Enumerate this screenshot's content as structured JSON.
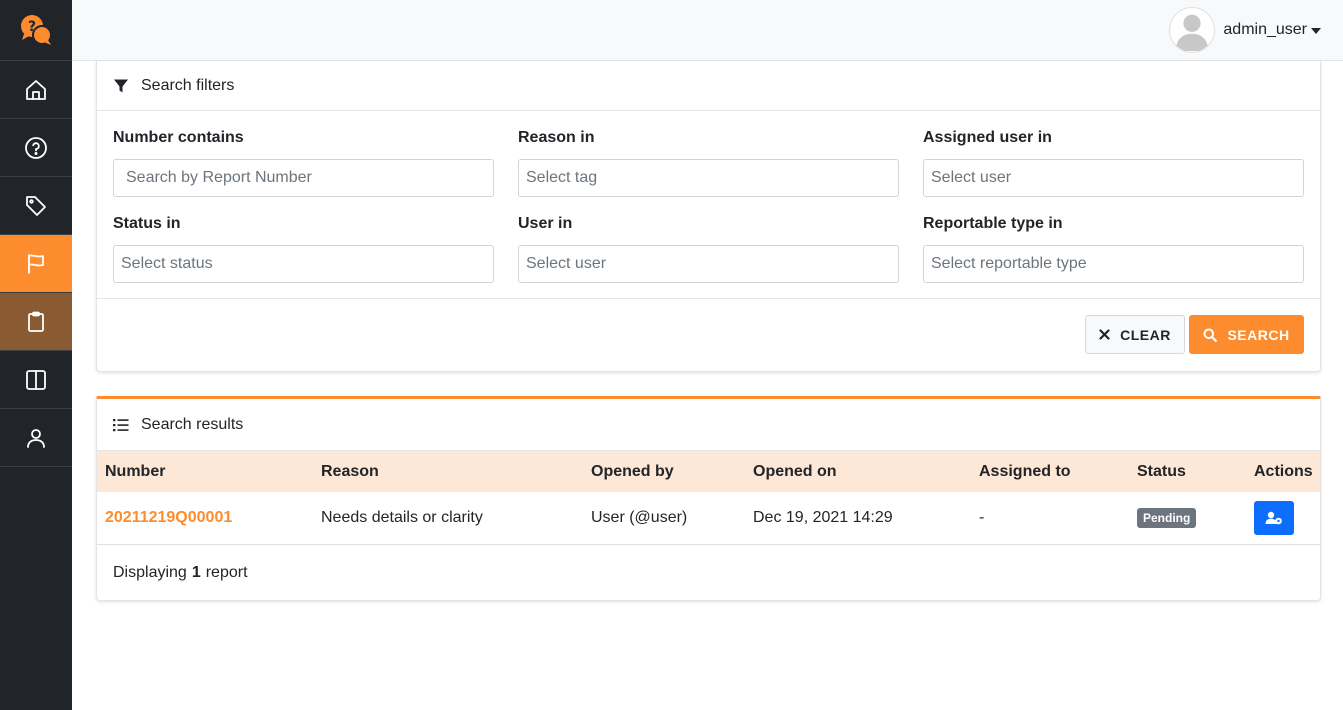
{
  "user": {
    "name": "admin_user"
  },
  "sidebar": {
    "items": [
      {
        "name": "home-icon"
      },
      {
        "name": "question-icon"
      },
      {
        "name": "tag-icon"
      },
      {
        "name": "flag-icon"
      },
      {
        "name": "clipboard-icon"
      },
      {
        "name": "columns-icon"
      },
      {
        "name": "person-icon"
      }
    ]
  },
  "filters": {
    "title": "Search filters",
    "number": {
      "label": "Number contains",
      "placeholder": "Search by Report Number"
    },
    "reason": {
      "label": "Reason in",
      "placeholder": "Select tag"
    },
    "assigned": {
      "label": "Assigned user in",
      "placeholder": "Select user"
    },
    "status": {
      "label": "Status in",
      "placeholder": "Select status"
    },
    "user": {
      "label": "User in",
      "placeholder": "Select user"
    },
    "reportable": {
      "label": "Reportable type in",
      "placeholder": "Select reportable type"
    },
    "clear_label": "CLEAR",
    "search_label": "SEARCH"
  },
  "results": {
    "title": "Search results",
    "columns": [
      "Number",
      "Reason",
      "Opened by",
      "Opened on",
      "Assigned to",
      "Status",
      "Actions"
    ],
    "rows": [
      {
        "number": "20211219Q00001",
        "reason": "Needs details or clarity",
        "opened_by": "User (@user)",
        "opened_on": "Dec 19, 2021 14:29",
        "assigned_to": "-",
        "status": "Pending"
      }
    ],
    "footer_prefix": "Displaying",
    "footer_count": "1",
    "footer_suffix": "report"
  },
  "colors": {
    "accent": "#fd8c2e",
    "sidebar": "#212529",
    "action": "#0d6efd"
  }
}
